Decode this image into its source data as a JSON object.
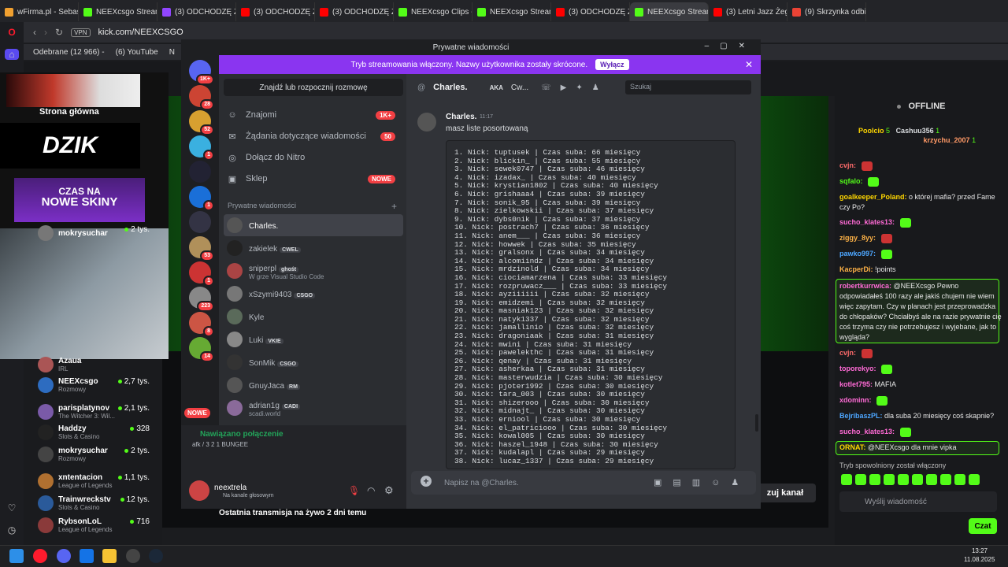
{
  "browser": {
    "tabs": [
      {
        "label": "wFirma.pl - Sebastian",
        "color": "#f0a030"
      },
      {
        "label": "NEEXcsgo Stream - W",
        "color": "#53fc18"
      },
      {
        "label": "(3) ODCHODZĘ Z TW",
        "color": "#9146ff"
      },
      {
        "label": "(3) ODCHODZĘ Z TW",
        "color": "#ff0000"
      },
      {
        "label": "(3) ODCHODZĘ Z TW",
        "color": "#ff0000"
      },
      {
        "label": "NEEXcsgo Clips - Wat",
        "color": "#53fc18"
      },
      {
        "label": "NEEXcsgo Stream - W",
        "color": "#53fc18"
      },
      {
        "label": "(3) ODCHODZĘ Z TW",
        "color": "#ff0000"
      },
      {
        "label": "NEEXcsgo Stream - Watch",
        "color": "#53fc18",
        "active": true
      },
      {
        "label": "(3) Letni Jazz Żegl",
        "color": "#ff0000"
      },
      {
        "label": "(9) Skrzynka odbiorc",
        "color": "#ea4335"
      }
    ],
    "url": "kick.com/NEEXCSGO",
    "vpn": "VPN",
    "bookmarks": [
      "Odebrane (12 966) -",
      "(6) YouTube",
      "N"
    ]
  },
  "kick": {
    "home": "Strona główna",
    "dzik": "DZIK",
    "skiny_top": "CZAS NA",
    "skiny_bottom": "NOWE SKINY",
    "channels": [
      {
        "name": "mokrysuchar",
        "cat": "",
        "views": "2 tys.",
        "color": "#777"
      },
      {
        "name": "Azaua",
        "cat": "IRL",
        "views": "",
        "color": "#a55"
      },
      {
        "name": "NEEXcsgo",
        "cat": "Rozmowy",
        "views": "2,7 tys.",
        "color": "#2d6cc0"
      },
      {
        "name": "parisplatynov",
        "cat": "The Witcher 3: Wil...",
        "views": "2,1 tys.",
        "color": "#7a5aa8"
      },
      {
        "name": "Haddzy",
        "cat": "Slots & Casino",
        "views": "328",
        "color": "#222"
      },
      {
        "name": "mokrysuchar",
        "cat": "Rozmowy",
        "views": "2 tys.",
        "color": "#444"
      },
      {
        "name": "xntentacion",
        "cat": "League of Legends",
        "views": "1,1 tys.",
        "color": "#b07030"
      },
      {
        "name": "Trainwreckstv",
        "cat": "Slots & Casino",
        "views": "12 tys.",
        "color": "#2a5a9a"
      },
      {
        "name": "RybsonLoL",
        "cat": "League of Legends",
        "views": "716",
        "color": "#8a3a3a"
      }
    ],
    "last_stream": "Ostatnia transmisja na żywo 2 dni temu",
    "follow": "zuj kanał",
    "chat": {
      "status": "OFFLINE",
      "top": [
        {
          "rank": "1",
          "name": "Poolcio",
          "val": "5"
        },
        {
          "name": "Cashuu356",
          "val": "1"
        },
        {
          "name": "krzychu_2007",
          "val": "1"
        }
      ],
      "messages": [
        {
          "user": "cvjn:",
          "text": "",
          "color": "#ff6b6b"
        },
        {
          "user": "sqfalo:",
          "text": "",
          "color": "#53fc18"
        },
        {
          "user": "goalkeeper_Poland:",
          "text": "o której mafia? przed Fame czy Po?",
          "color": "#ffd700"
        },
        {
          "user": "sucho_klates13:",
          "text": "",
          "color": "#ff6bd6"
        },
        {
          "user": "ziggy_8yy:",
          "text": "",
          "color": "#ffb347"
        },
        {
          "user": "pawko997:",
          "text": "",
          "color": "#4da6ff"
        },
        {
          "user": "KacperDi:",
          "text": "!points",
          "color": "#ffb347"
        },
        {
          "user": "robertkurrwica:",
          "text": "@NEEXcsgo Pewno odpowiadałeś 100 razy ale jakiś chujem nie wiem więc zapytam. Czy w planach jest przeprowadzka do chłopaków? Chciałbyś ale na razie prywatnie cię coś trzyma czy nie potrzebujesz i wyjebane, jak to wygląda?",
          "color": "#ff6bd6"
        },
        {
          "user": "cvjn:",
          "text": "",
          "color": "#ff6b6b"
        },
        {
          "user": "toporekyo:",
          "text": "",
          "color": "#ff6bd6"
        },
        {
          "user": "kotlet795:",
          "text": "MAFIA",
          "color": "#ff6bd6"
        },
        {
          "user": "xdominn:",
          "text": "",
          "color": "#ff6bd6"
        },
        {
          "user": "BejribaszPL:",
          "text": "dla suba 20 miesięcy coś skapnie?",
          "color": "#4da6ff"
        },
        {
          "user": "sucho_klates13:",
          "text": "",
          "color": "#ff6bd6"
        },
        {
          "user": "ORNAT:",
          "text": "@NEEXcsgo dla mnie vipka",
          "color": "#ffd700"
        }
      ],
      "slowmode": "Tryb spowolniony został włączony",
      "placeholder": "Wyślij wiadomość",
      "send": "Czat"
    }
  },
  "discord": {
    "title": "Prywatne wiadomości",
    "banner": "Tryb streamowania włączony. Nazwy użytkownika zostały skrócone.",
    "banner_btn": "Wyłącz",
    "find": "Znajdź lub rozpocznij rozmowę",
    "nav": [
      {
        "label": "Znajomi",
        "badge": "1K+"
      },
      {
        "label": "Żądania dotyczące wiadomości",
        "badge": "50"
      },
      {
        "label": "Dołącz do Nitro",
        "badge": ""
      },
      {
        "label": "Sklep",
        "badge": "NOWE"
      }
    ],
    "dm_header": "Prywatne wiadomości",
    "dms": [
      {
        "name": "Charles.",
        "sub": "",
        "tag": "",
        "color": "#555",
        "sel": true
      },
      {
        "name": "zakielek",
        "sub": "",
        "tag": "CWEL",
        "color": "#222"
      },
      {
        "name": "sniperpl",
        "sub": "W grze Visual Studio Code",
        "tag": "ghośt",
        "color": "#a44"
      },
      {
        "name": "xSzymi9403",
        "sub": "",
        "tag": "CSGO",
        "color": "#777"
      },
      {
        "name": "Kyle",
        "sub": "",
        "tag": "",
        "color": "#5a6a5a"
      },
      {
        "name": "Luki",
        "sub": "",
        "tag": "VKIE",
        "color": "#888"
      },
      {
        "name": "SonMik",
        "sub": "",
        "tag": "CSGO",
        "color": "#333"
      },
      {
        "name": "GnuyJaca",
        "sub": "",
        "tag": "RM",
        "color": "#555"
      },
      {
        "name": "adrian1g",
        "sub": "scadi.world",
        "tag": "CADI",
        "color": "#8a6a9a"
      }
    ],
    "servers": [
      {
        "badge": "1K+",
        "color": "#5865f2"
      },
      {
        "badge": "28",
        "color": "#c43"
      },
      {
        "badge": "52",
        "color": "#d8a030"
      },
      {
        "badge": "1",
        "color": "#3ab0e0"
      },
      {
        "badge": "",
        "color": "#223"
      },
      {
        "badge": "1",
        "color": "#1a6fd8"
      },
      {
        "badge": "",
        "color": "#334"
      },
      {
        "badge": "53",
        "color": "#b0905a"
      },
      {
        "badge": "1",
        "color": "#c33"
      },
      {
        "badge": "223",
        "color": "#888"
      },
      {
        "badge": "8",
        "color": "#c54"
      },
      {
        "badge": "14",
        "color": "#6a3"
      }
    ],
    "new_label": "NOWE",
    "voice_title": "Nawiązano połączenie",
    "voice_sub": "afk / 3 2 1 BUNGEE",
    "user": "neextrela",
    "user_status": "Na kanale głosowym",
    "chat_name": "Charles.",
    "aka": "AKA",
    "aka_name": "Cw...",
    "search": "Szukaj",
    "msg_author": "Charles.",
    "msg_time": "11:17",
    "msg_text": "masz liste posortowaną",
    "list": [
      "1. Nick: tuptusek | Czas suba: 66 miesięcy",
      "2. Nick: blickin_ | Czas suba: 55 miesięcy",
      "3. Nick: sewek0747 | Czas suba: 46 miesięcy",
      "4. Nick: izadax_ | Czas suba: 40 miesięcy",
      "5. Nick: krystian1802 | Czas suba: 40 miesięcy",
      "6. Nick: grishaaa4 | Czas suba: 39 miesięcy",
      "7. Nick: sonik_95 | Czas suba: 39 miesięcy",
      "8. Nick: zielkowskii | Czas suba: 37 miesięcy",
      "9. Nick: dybs0nik | Czas suba: 37 miesięcy",
      "10. Nick: postrach7 | Czas suba: 36 miesięcy",
      "11. Nick: anem___ | Czas suba: 36 miesięcy",
      "12. Nick: howwek | Czas suba: 35 miesięcy",
      "13. Nick: gralsonx | Czas suba: 34 miesięcy",
      "14. Nick: alcomiindz | Czas suba: 34 miesięcy",
      "15. Nick: mrdzinold | Czas suba: 34 miesięcy",
      "16. Nick: ciociamarzena | Czas suba: 33 miesięcy",
      "17. Nick: rozpruwacz___ | Czas suba: 33 miesięcy",
      "18. Nick: ayziiiiii | Czas suba: 32 miesięcy",
      "19. Nick: emidzemi | Czas suba: 32 miesięcy",
      "20. Nick: masniak123 | Czas suba: 32 miesięcy",
      "21. Nick: natyk1337 | Czas suba: 32 miesięcy",
      "22. Nick: jamallinio | Czas suba: 32 miesięcy",
      "23. Nick: dragoniaak | Czas suba: 31 miesięcy",
      "24. Nick: mwini | Czas suba: 31 miesięcy",
      "25. Nick: pawelekthc | Czas suba: 31 miesięcy",
      "26. Nick: qenay | Czas suba: 31 miesięcy",
      "27. Nick: asherkaa | Czas suba: 31 miesięcy",
      "28. Nick: masterwudzia | Czas suba: 30 miesięcy",
      "29. Nick: pjoter1992 | Czas suba: 30 miesięcy",
      "30. Nick: tara_003 | Czas suba: 30 miesięcy",
      "31. Nick: shizerooo | Czas suba: 30 miesięcy",
      "32. Nick: midnajt_ | Czas suba: 30 miesięcy",
      "33. Nick: erniool | Czas suba: 30 miesięcy",
      "34. Nick: el_patriciooo | Czas suba: 30 miesięcy",
      "35. Nick: kowal005 | Czas suba: 30 miesięcy",
      "36. Nick: haszel_1948 | Czas suba: 30 miesięcy",
      "37. Nick: kudalapl | Czas suba: 29 miesięcy",
      "38. Nick: lucaz_1337 | Czas suba: 29 miesięcy"
    ],
    "input_placeholder": "Napisz na @Charles."
  },
  "taskbar": {
    "time": "13:27",
    "date": "11.08.2025"
  }
}
